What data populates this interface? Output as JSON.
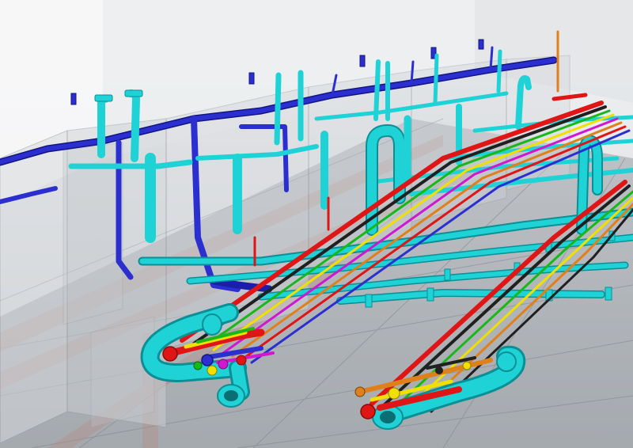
{
  "scene": {
    "kind": "3d-piping-model-render",
    "text_labels": [],
    "colors": {
      "cyan_pipe": "#1fd2d6",
      "cyan_dark": "#0a8f96",
      "blue_pipe": "#2c2fd0",
      "blue_dark": "#121580",
      "red_pipe": "#e01515",
      "yellow_pipe": "#f0e000",
      "green_pipe": "#18b818",
      "magenta_pipe": "#d018d0",
      "orange_pipe": "#e08018",
      "black_pipe": "#202020",
      "wall_glass": "#cfd3d8",
      "floor_grid": "#8f9499",
      "rust_beam": "#b88a80"
    }
  }
}
